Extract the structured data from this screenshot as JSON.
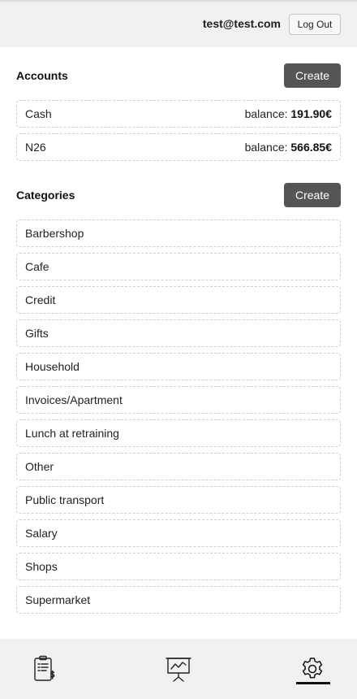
{
  "header": {
    "email": "test@test.com",
    "logout_label": "Log Out"
  },
  "accounts": {
    "title": "Accounts",
    "create_label": "Create",
    "balance_prefix": "balance: ",
    "items": [
      {
        "name": "Cash",
        "balance": "191.90€"
      },
      {
        "name": "N26",
        "balance": "566.85€"
      }
    ]
  },
  "categories": {
    "title": "Categories",
    "create_label": "Create",
    "items": [
      "Barbershop",
      "Cafe",
      "Credit",
      "Gifts",
      "Household",
      "Invoices/Apartment",
      "Lunch at retraining",
      "Other",
      "Public transport",
      "Salary",
      "Shops",
      "Supermarket"
    ]
  },
  "nav": {
    "items": [
      {
        "icon": "invoice-clipboard-icon"
      },
      {
        "icon": "presentation-chart-icon"
      },
      {
        "icon": "gear-icon",
        "active": true
      }
    ]
  }
}
